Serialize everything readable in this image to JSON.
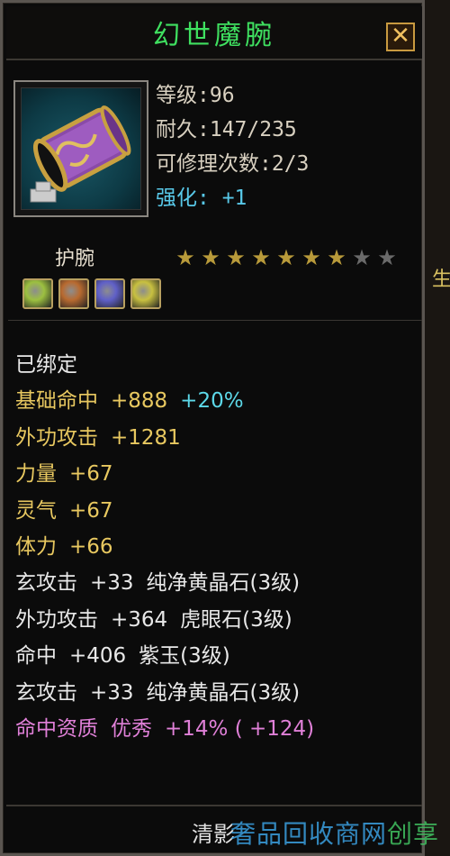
{
  "window": {
    "title": "幻世魔腕",
    "close_label": "✕"
  },
  "item": {
    "level": "等级:96",
    "durability": "耐久:147/235",
    "repair": "可修理次数:2/3",
    "enhance": "强化: +1",
    "slot": "护腕",
    "stars_filled": 7,
    "stars_total": 9
  },
  "gem_slots": [
    {
      "name": "yellow-green-gem",
      "color": "#9cc040"
    },
    {
      "name": "brown-gem",
      "color": "#b86a30"
    },
    {
      "name": "purple-gem",
      "color": "#6060c8"
    },
    {
      "name": "yellow-green-gem",
      "color": "#c8c040"
    }
  ],
  "attributes": [
    {
      "label": "已绑定",
      "color": "c-white"
    },
    {
      "label": "基础命中",
      "value": "+888",
      "extra": "+20%",
      "color": "c-yellow"
    },
    {
      "label": "外功攻击",
      "value": "+1281",
      "color": "c-yellow"
    },
    {
      "label": "力量",
      "value": "+67",
      "color": "c-yellow"
    },
    {
      "label": "灵气",
      "value": "+67",
      "color": "c-yellow"
    },
    {
      "label": "体力",
      "value": "+66",
      "color": "c-yellow"
    },
    {
      "label": "玄攻击",
      "value": "+33",
      "gem": "纯净黄晶石(3级)",
      "color": "c-white"
    },
    {
      "label": "外功攻击",
      "value": "+364",
      "gem": "虎眼石(3级)",
      "color": "c-white"
    },
    {
      "label": "命中",
      "value": "+406",
      "gem": "紫玉(3级)",
      "color": "c-white"
    },
    {
      "label": "玄攻击",
      "value": "+33",
      "gem": "纯净黄晶石(3级)",
      "color": "c-white"
    },
    {
      "label": "命中资质",
      "value": "优秀",
      "extra": "+14% ( +124)",
      "color": "c-pink"
    }
  ],
  "footer": {
    "server": "清影",
    "watermark": "奢品回收商网",
    "watermark_tail": "创享"
  },
  "edge_text": "生"
}
